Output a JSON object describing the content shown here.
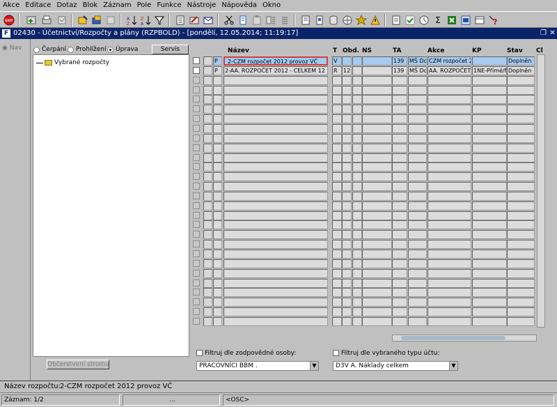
{
  "menu": [
    "Akce",
    "Editace",
    "Dotaz",
    "Blok",
    "Záznam",
    "Pole",
    "Funkce",
    "Nástroje",
    "Nápověda",
    "Okno"
  ],
  "toolbar": {
    "exit_label": "EXIT",
    "buttons": [
      "save-icon",
      "print-icon",
      "open-icon",
      "new-record-icon",
      "copy-icon",
      "delete-icon",
      "sort-asc-icon",
      "sort-desc-icon",
      "filter-icon",
      "document-icon",
      "edit-icon",
      "mail-icon",
      "cut-icon",
      "copy-text-icon",
      "paste-icon",
      "list-icon",
      "calendar-icon",
      "notes-icon",
      "settings-icon",
      "star-icon",
      "warning-icon",
      "report-icon",
      "check-icon",
      "sum-icon",
      "excel-icon",
      "image-icon",
      "help-icon"
    ]
  },
  "window": {
    "icon_text": "F",
    "title": "02430 - Účetnictví/Rozpočty a plány (RZPBOLD) - [pondělí, 12.05.2014; 11:19:17]"
  },
  "nav": {
    "tab_label": "Nav"
  },
  "modes": [
    {
      "label": "Čerpání",
      "selected": false
    },
    {
      "label": "Prohlížení",
      "selected": false
    },
    {
      "label": "Úprava",
      "selected": true
    }
  ],
  "servis_label": "Servis",
  "tree": {
    "root_label": "Vybrané rozpočty"
  },
  "refresh_label": "Občerstvení stromu",
  "grid": {
    "headers": {
      "nazev": "Název",
      "t": "T",
      "obd": "Obd.",
      "ns": "NS",
      "ta": "TA",
      "akce": "Akce",
      "kp": "KP",
      "stav": "Stav",
      "cl": "Cl"
    },
    "rows": [
      {
        "p": "P",
        "nazev": "2-CZM rozpočet 2012 provoz VČ",
        "t": "V",
        "obd": "",
        "ns": "",
        "ta": "139",
        "ms": "MŠ Do",
        "akce": "CZM rozpočet 2",
        "kp": "",
        "stav": "Doplněn"
      },
      {
        "p": "P",
        "nazev": "2-AA. ROZPOČET 2012 - CELKEM 12",
        "t": "R",
        "obd": "12",
        "ns": "",
        "ta": "139",
        "ms": "MŠ Do",
        "akce": "AA. ROZPOČET",
        "kp": "1NE-Přímé/N",
        "stav": "Doplněn"
      }
    ]
  },
  "filters": {
    "person_label": "Filtruj dle zodpovědné osoby:",
    "person_value": "PRACOVNÍCI BBM .",
    "account_label": "Filtruj dle vybraného typu účtu:",
    "account_value": "D3V A. Náklady celkem"
  },
  "footer": {
    "name_label": "Název rozpočtu:",
    "name_value": "2-CZM rozpočet 2012 provoz VČ"
  },
  "status": {
    "record": "Záznam: 1/2",
    "seg2": "...",
    "mode": "<OSC>"
  },
  "colors": {
    "title_bg": "#0a246a",
    "selected_row": "#a6caf0",
    "selected_border": "#d04040"
  }
}
